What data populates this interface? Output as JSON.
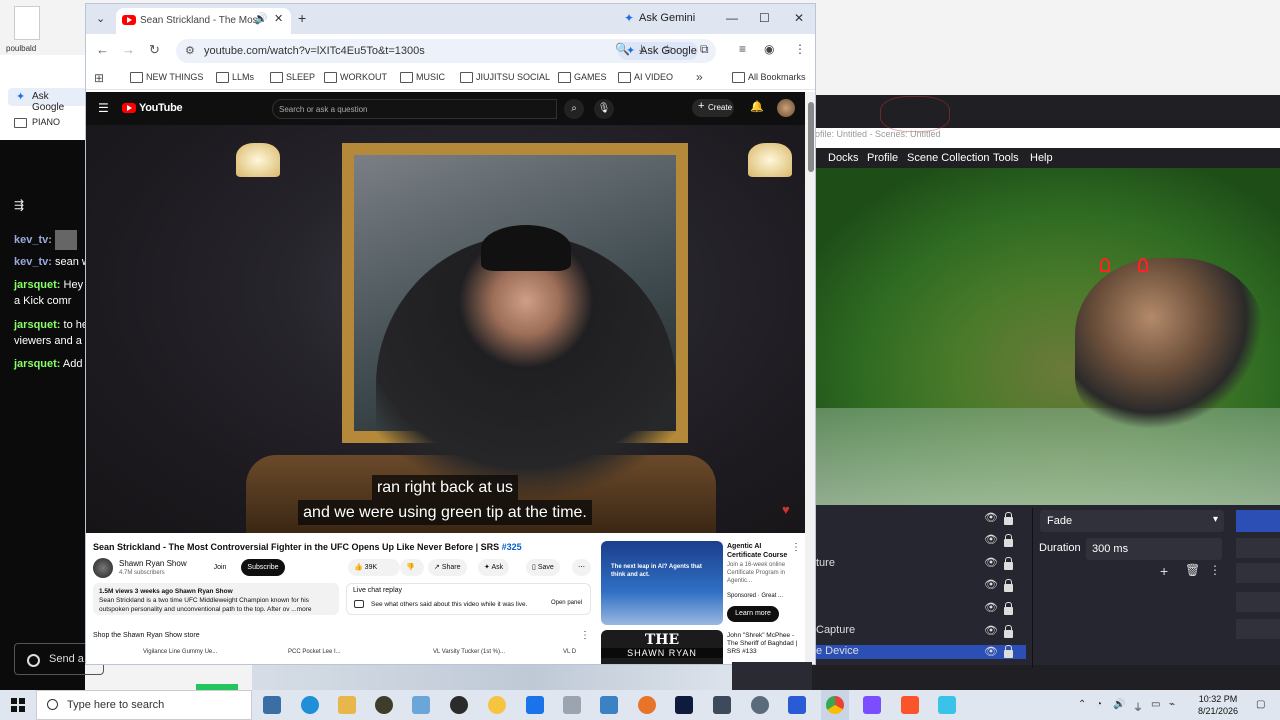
{
  "desktop": {
    "icon_label": "poulbald"
  },
  "left_browser": {
    "ask_google": "Ask Google",
    "bookmark": "PIANO"
  },
  "chat": {
    "menu_icon": "menu-lines-icon",
    "messages": [
      {
        "user": "kev_tv:",
        "text": ""
      },
      {
        "user": "kev_tv:",
        "text": "sean w"
      },
      {
        "user": "jarsquet:",
        "text": "Hey"
      },
      {
        "user": "",
        "text": "a Kick comr"
      },
      {
        "user": "jarsquet:",
        "text": "to he"
      },
      {
        "user": "",
        "text": "viewers and a"
      },
      {
        "user": "jarsquet:",
        "text": "Add"
      }
    ],
    "input_placeholder": "Send a"
  },
  "chrome": {
    "tab": {
      "title": "Sean Strickland - The Most",
      "icons": [
        "speaker-icon",
        "close-icon"
      ]
    },
    "new_tab": "+",
    "ask_gemini": "Ask Gemini",
    "window_controls": [
      "—",
      "☐",
      "✕"
    ],
    "url": "youtube.com/watch?v=lXITc4Eu5To&t=1300s",
    "ask_google": "Ask Google",
    "bookmarks": [
      "NEW THINGS",
      "LLMs",
      "SLEEP",
      "WORKOUT",
      "MUSIC",
      "JIUJITSU SOCIAL",
      "GAMES",
      "AI VIDEO"
    ],
    "bookmarks_more": "»",
    "all_bookmarks": "All Bookmarks"
  },
  "youtube": {
    "logo_text": "YouTube",
    "search_placeholder": "Search or ask a question",
    "create": "Create",
    "subtitle_lines": [
      "ran right back at us",
      "and we were using green tip at the time."
    ],
    "video_title": "Sean Strickland - The Most Controversial Fighter in the UFC Opens Up Like Never Before | SRS ",
    "video_tag": "#325",
    "channel_name": "Shawn Ryan Show",
    "channel_subs": "4.7M subscribers",
    "join": "Join",
    "subscribe": "Subscribe",
    "likes": "39K",
    "share": "Share",
    "ask": "Ask",
    "save": "Save",
    "description_stats": "1.5M views  3 weeks ago  Shawn Ryan Show",
    "description_text": "Sean Strickland is a two time UFC Middleweight Champion known for his outspoken personality and unconventional path to the top. After ov ...more",
    "live_chat_title": "Live chat replay",
    "live_chat_msg": "See what others said about this video while it was live.",
    "live_chat_btn": "Open panel",
    "shop_title": "Shop the Shawn Ryan Show store",
    "shop_items": [
      "Vigilance Line Gummy Ue...",
      "PCC Pocket Lee I...",
      "VL Varsity Tucker (1st %)...",
      "VL D"
    ],
    "ad": {
      "thumb_text": "The next leap in AI? Agents that think and act.",
      "title": "Agentic AI Certificate Course",
      "desc": "Join a 16-week online Certificate Program in Agentic...",
      "sponsor": "Sponsored · Great ...",
      "button": "Learn more"
    },
    "rec": {
      "thumb_line1": "THE",
      "thumb_line2": "SHAWN RYAN",
      "title": "John \"Shrek\" McPhee - The Sheriff of Baghdad | SRS #133"
    }
  },
  "obs": {
    "title": "ofile: Untitled - Scenes: Untitled",
    "menu": [
      "Docks",
      "Profile",
      "Scene Collection",
      "Tools",
      "Help"
    ],
    "sources": [
      {
        "label": "",
        "selected": false
      },
      {
        "label": "",
        "selected": false
      },
      {
        "label": "ture",
        "selected": false
      },
      {
        "label": "",
        "selected": false
      },
      {
        "label": "",
        "selected": false
      },
      {
        "label": "Capture",
        "selected": false
      },
      {
        "label": "e Device",
        "selected": true
      }
    ],
    "transition": "Fade",
    "duration_label": "Duration",
    "duration_value": "300 ms"
  },
  "taskbar": {
    "search_placeholder": "Type here to search",
    "time": "10:32 PM",
    "date": "8/21/2026"
  }
}
